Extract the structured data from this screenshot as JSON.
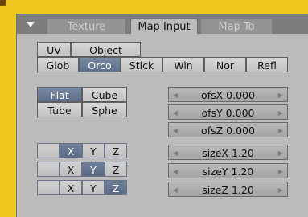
{
  "tabs": [
    {
      "label": "Texture",
      "active": false
    },
    {
      "label": "Map Input",
      "active": true
    },
    {
      "label": "Map To",
      "active": false
    }
  ],
  "coord_row1": [
    {
      "label": "UV",
      "selected": false
    },
    {
      "label": "Object",
      "selected": false
    }
  ],
  "coord_row2": [
    {
      "label": "Glob",
      "selected": false
    },
    {
      "label": "Orco",
      "selected": true
    },
    {
      "label": "Stick",
      "selected": false
    },
    {
      "label": "Win",
      "selected": false
    },
    {
      "label": "Nor",
      "selected": false
    },
    {
      "label": "Refl",
      "selected": false
    }
  ],
  "projection": [
    {
      "label": "Flat",
      "selected": true
    },
    {
      "label": "Cube",
      "selected": false
    },
    {
      "label": "Tube",
      "selected": false
    },
    {
      "label": "Sphe",
      "selected": false
    }
  ],
  "offset": [
    {
      "label": "ofsX 0.000"
    },
    {
      "label": "ofsY 0.000"
    },
    {
      "label": "ofsZ 0.000"
    }
  ],
  "size": [
    {
      "label": "sizeX 1.20"
    },
    {
      "label": "sizeY 1.20"
    },
    {
      "label": "sizeZ 1.20"
    }
  ],
  "axis_mapping": [
    {
      "cells": [
        {
          "label": "",
          "selected": false
        },
        {
          "label": "X",
          "selected": true
        },
        {
          "label": "Y",
          "selected": false
        },
        {
          "label": "Z",
          "selected": false
        }
      ]
    },
    {
      "cells": [
        {
          "label": "",
          "selected": false
        },
        {
          "label": "X",
          "selected": false
        },
        {
          "label": "Y",
          "selected": true
        },
        {
          "label": "Z",
          "selected": false
        }
      ]
    },
    {
      "cells": [
        {
          "label": "",
          "selected": false
        },
        {
          "label": "X",
          "selected": false
        },
        {
          "label": "Y",
          "selected": false
        },
        {
          "label": "Z",
          "selected": true
        }
      ]
    }
  ],
  "arrows": {
    "left": "◀",
    "right": "▶"
  },
  "colors": {
    "background": "#eec81d",
    "panel": "#bbbbbb",
    "header": "#7c7c7c",
    "selected": "#5d6e8b"
  }
}
